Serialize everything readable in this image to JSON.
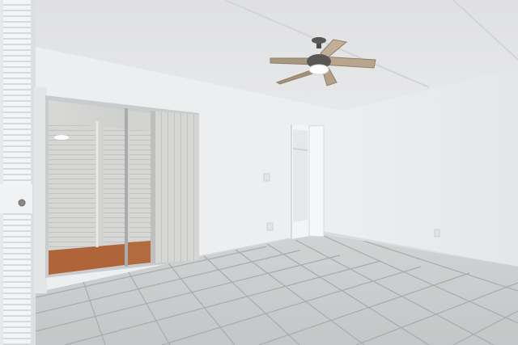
{
  "scene": {
    "kind": "empty-room-photo",
    "elements": [
      "textured-ceiling",
      "ceiling-fan-with-light",
      "sliding-glass-door",
      "vertical-blinds",
      "closet-louvered-door",
      "open-doorway",
      "tile-floor",
      "wall-outlet",
      "light-switch"
    ]
  },
  "colors": {
    "wall": "#eceef0",
    "wall_shade": "#e2e4e7",
    "ceiling": "#e3e4e6",
    "floor_tile": "#c9cbcc",
    "grout": "#a9abac",
    "fan_blade": "#b8a58c",
    "fan_body": "#5a5654",
    "door_frame": "#bfc2c4",
    "exterior_floor": "#b0643a",
    "blind": "#d4d5d3"
  }
}
